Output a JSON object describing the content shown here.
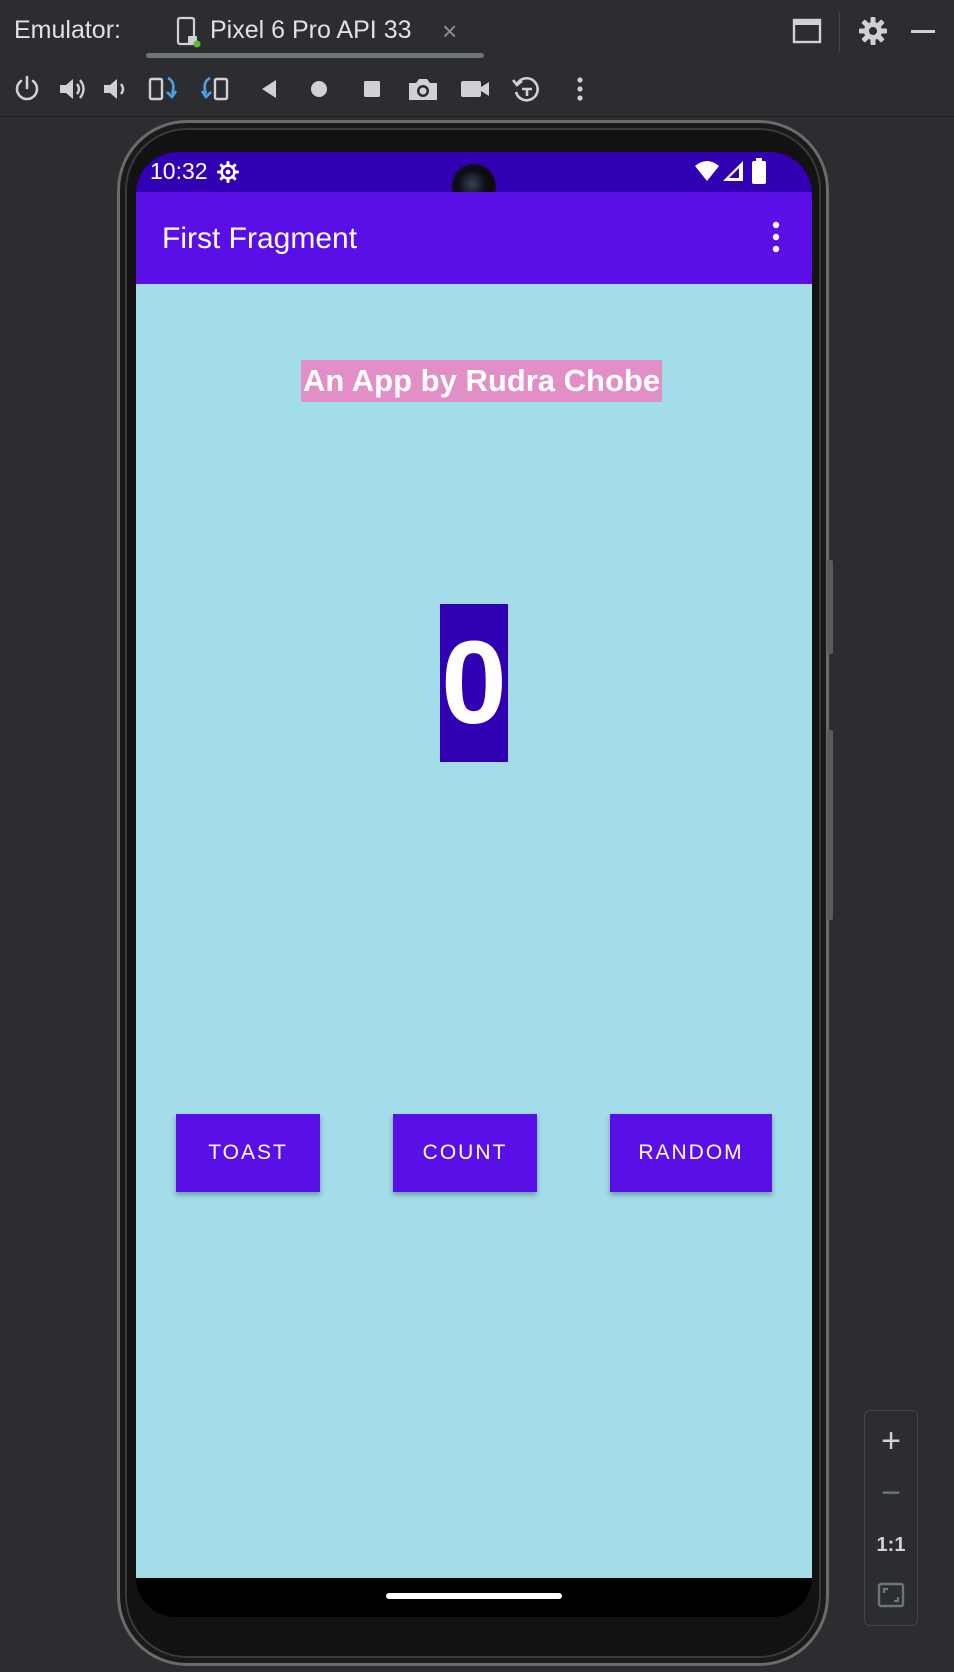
{
  "emulator_tabbar": {
    "label": "Emulator:",
    "device_tab": "Pixel 6 Pro API 33",
    "close_glyph": "×"
  },
  "toolbar": {
    "icons": [
      "power-icon",
      "volume-up-icon",
      "volume-down-icon",
      "rotate-left-icon",
      "rotate-right-icon",
      "back-icon",
      "home-icon",
      "overview-icon",
      "screenshot-icon",
      "screen-record-icon",
      "snapshot-icon",
      "more-icon"
    ]
  },
  "zoom": {
    "zoom_in": "+",
    "zoom_out": "−",
    "actual_size": "1:1"
  },
  "phone": {
    "status_bar": {
      "time": "10:32"
    },
    "app_bar": {
      "title": "First Fragment"
    },
    "content": {
      "credit": "An App by Rudra Chobe",
      "count": "0",
      "buttons": {
        "toast": "TOAST",
        "count": "COUNT",
        "random": "RANDOM"
      }
    }
  },
  "colors": {
    "status_bar": "#3200b3",
    "app_bar": "#5a0fe6",
    "background": "#a2dde9",
    "credit_bg": "#e28fc8",
    "count_bg": "#3200b3",
    "button_bg": "#5a0fe6",
    "fab": "#5fd8c7"
  }
}
